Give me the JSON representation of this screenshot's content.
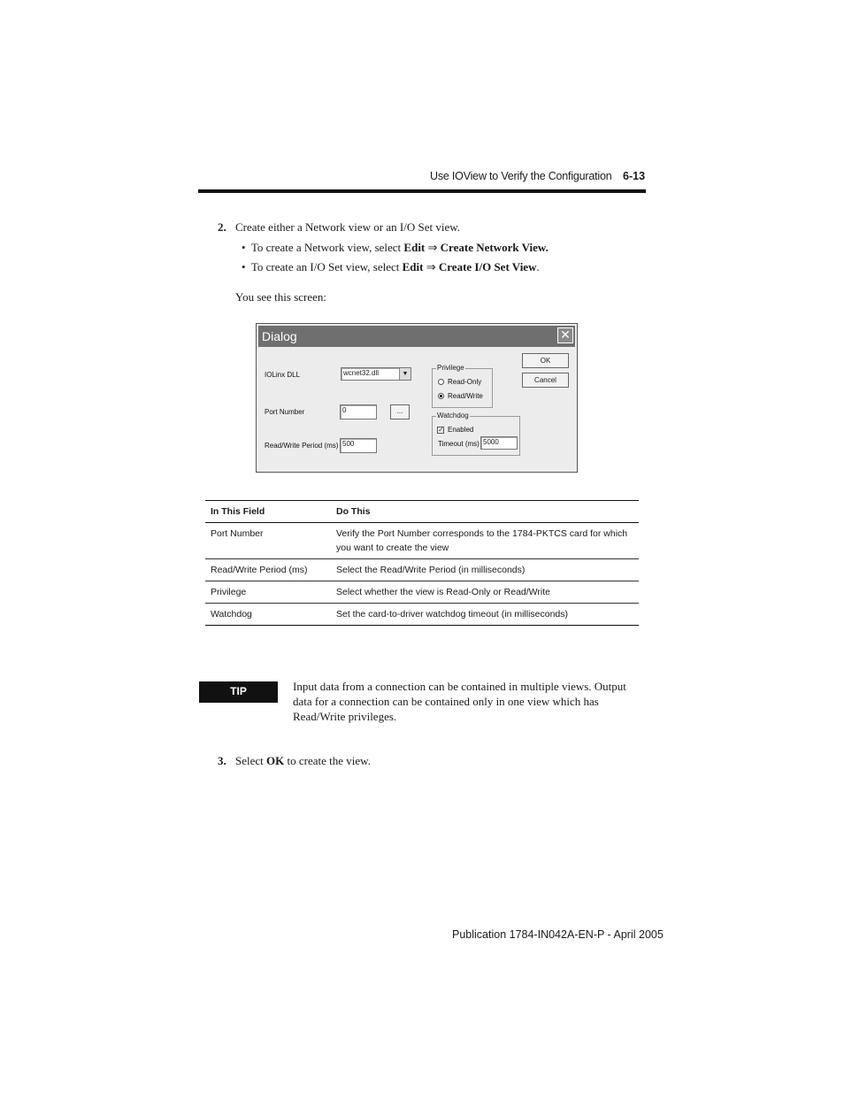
{
  "header": {
    "title": "Use IOView to Verify the Configuration",
    "page": "6-13"
  },
  "step2": {
    "number": "2.",
    "text": "Create either a Network view or an I/O Set view.",
    "bullets": [
      {
        "prefix": "To create a Network view, select ",
        "menu": "Edit",
        "arrow": "⇒",
        "item": "Create Network View.",
        "suffix": ""
      },
      {
        "prefix": "To create an I/O Set view, select ",
        "menu": "Edit",
        "arrow": "⇒",
        "item": "Create I/O Set View",
        "suffix": "."
      }
    ],
    "see_screen": "You see this screen:"
  },
  "dialog": {
    "title": "Dialog",
    "iolinx_label": "IOLinx DLL",
    "iolinx_value": "wcnet32.dll",
    "port_label": "Port Number",
    "port_value": "0",
    "browse_label": "...",
    "period_label": "Read/Write Period (ms)",
    "period_value": "500",
    "privilege_legend": "Privilege",
    "read_only_label": "Read-Only",
    "read_write_label": "Read/Write",
    "watchdog_legend": "Watchdog",
    "enabled_label": "Enabled",
    "timeout_label": "Timeout (ms)",
    "timeout_value": "5000",
    "ok_label": "OK",
    "cancel_label": "Cancel",
    "check_mark": "✓",
    "close_glyph": "✕"
  },
  "table": {
    "headers": [
      "In This Field",
      "Do This"
    ],
    "rows": [
      [
        "Port Number",
        "Verify the Port Number corresponds to the 1784-PKTCS card for which you want to create the view"
      ],
      [
        "Read/Write Period (ms)",
        "Select the Read/Write Period (in milliseconds)"
      ],
      [
        "Privilege",
        "Select whether the view is Read-Only or Read/Write"
      ],
      [
        "Watchdog",
        "Set the card-to-driver watchdog timeout (in milliseconds)"
      ]
    ]
  },
  "tip": {
    "label": "TIP",
    "text": "Input data from a connection can be contained in multiple views. Output data for a connection can be contained only in one view which has Read/Write privileges."
  },
  "step3": {
    "number": "3.",
    "prefix": "Select ",
    "bold": "OK",
    "suffix": " to create the view."
  },
  "footer": "Publication 1784-IN042A-EN-P - April 2005"
}
